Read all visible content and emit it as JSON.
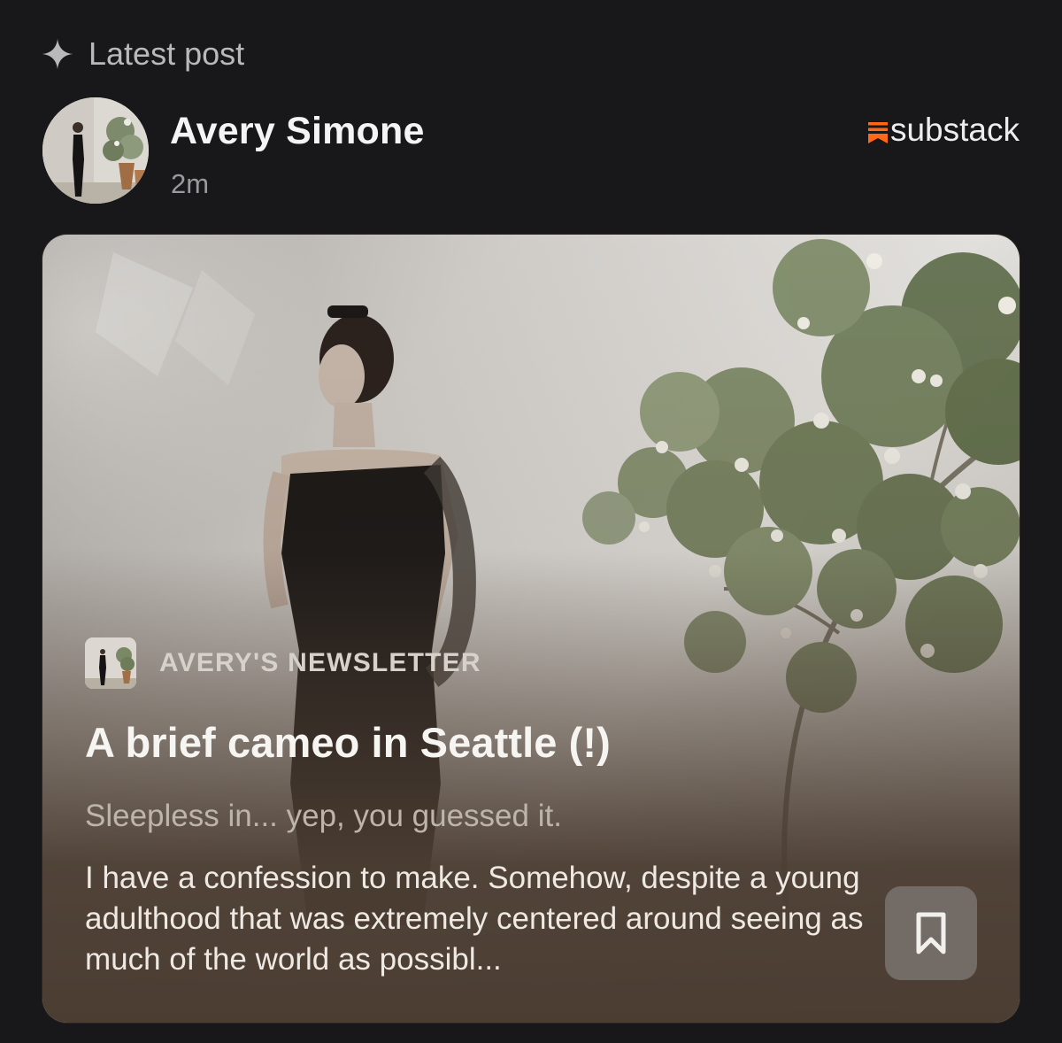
{
  "section": {
    "label": "Latest post",
    "icon": "sparkle-icon"
  },
  "author": {
    "name": "Avery Simone",
    "time": "2m"
  },
  "brand": {
    "name": "substack",
    "accent": "#ff6719"
  },
  "post": {
    "publication": "AVERY'S NEWSLETTER",
    "title": "A brief cameo in Seattle (!)",
    "subtitle": "Sleepless in... yep, you guessed it.",
    "excerpt": "I have a confession to make. Somehow, despite a young adulthood that was extremely centered around seeing as much of the world as possibl...",
    "bookmark_icon": "bookmark-icon"
  },
  "colors": {
    "background": "#18181a",
    "card": "#4b3d32",
    "bookmark_button": "#736b65"
  }
}
